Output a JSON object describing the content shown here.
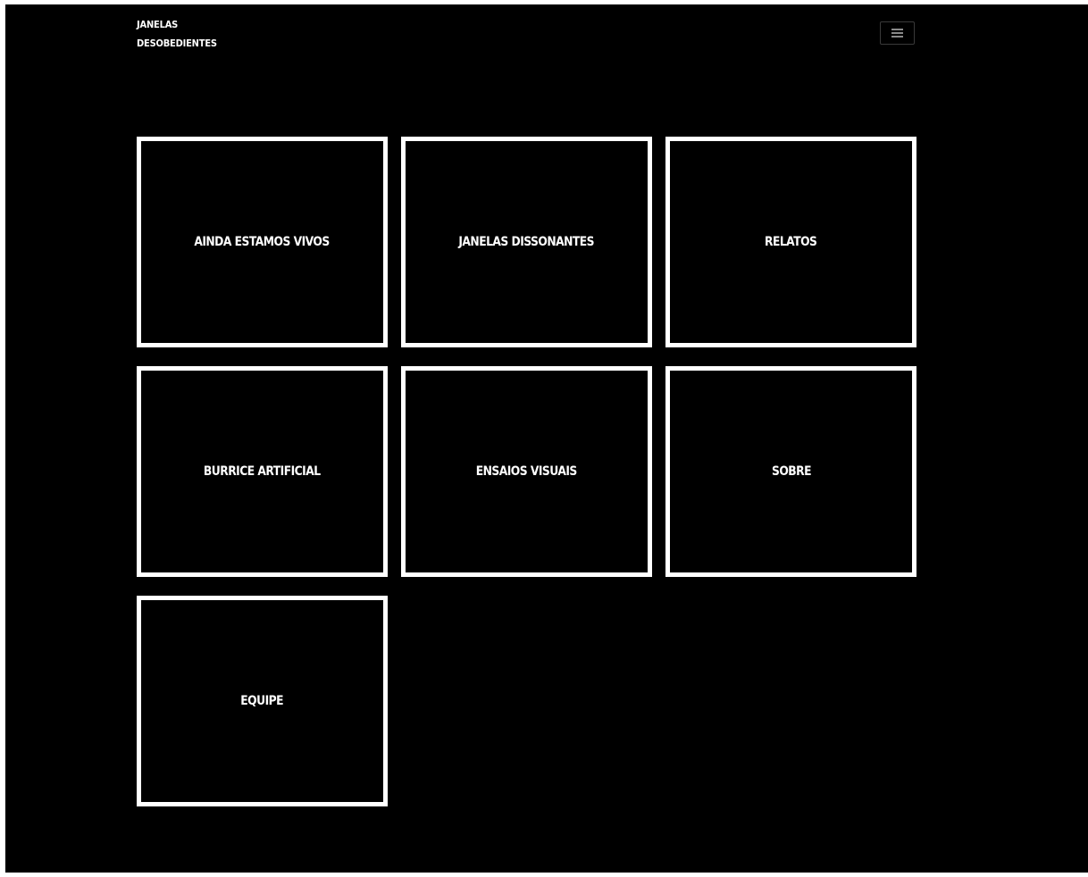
{
  "header": {
    "brand_line1": "JANELAS",
    "brand_line2": "DESOBEDIENTES",
    "menu_icon": "hamburger-menu-icon"
  },
  "tiles": [
    {
      "label": "AINDA ESTAMOS VIVOS"
    },
    {
      "label": "JANELAS DISSONANTES"
    },
    {
      "label": "RELATOS"
    },
    {
      "label": "BURRICE ARTIFICIAL"
    },
    {
      "label": "ENSAIOS VISUAIS"
    },
    {
      "label": "SOBRE"
    },
    {
      "label": "EQUIPE"
    }
  ],
  "colors": {
    "background": "#000000",
    "foreground": "#ffffff",
    "toggle_border": "#3a3a3a"
  }
}
